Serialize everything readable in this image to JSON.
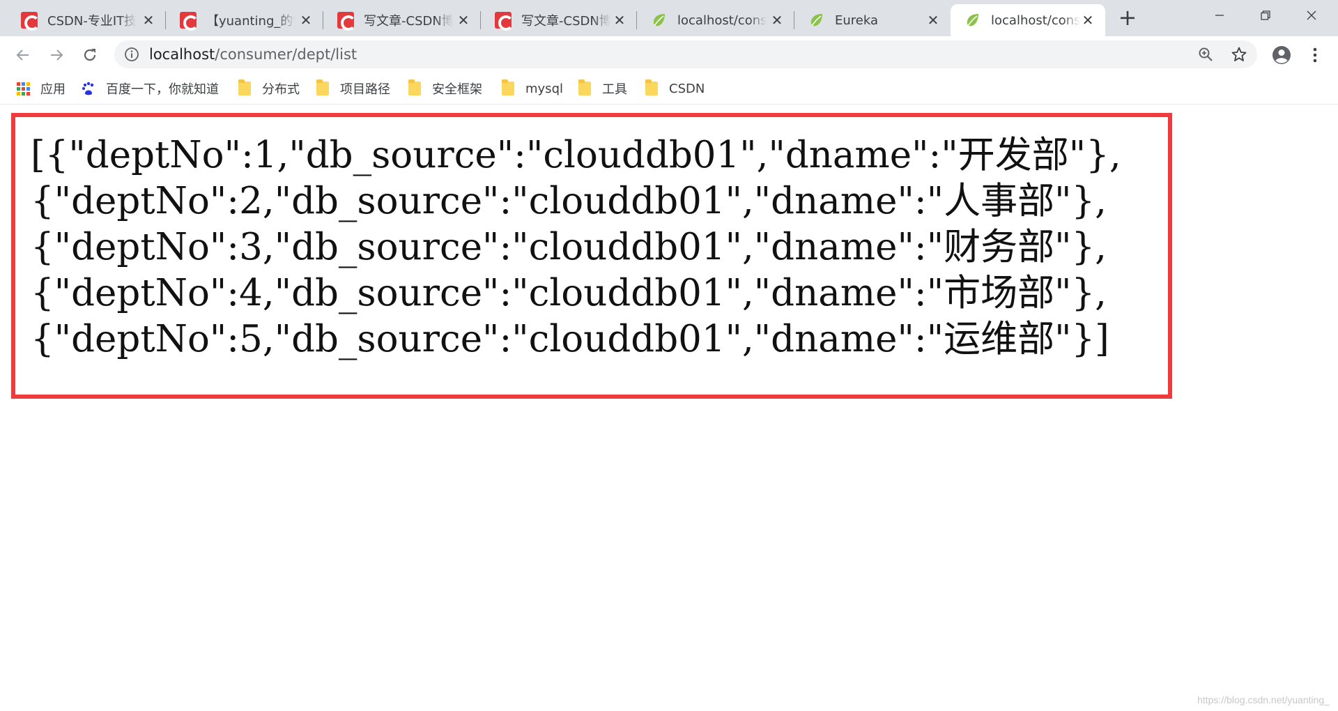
{
  "tabs": [
    {
      "title": "CSDN-专业IT技",
      "favicon": "csdn-icon",
      "active": false
    },
    {
      "title": "【yuanting_的博",
      "favicon": "csdn-icon",
      "active": false
    },
    {
      "title": "写文章-CSDN博",
      "favicon": "csdn-icon",
      "active": false
    },
    {
      "title": "写文章-CSDN博",
      "favicon": "csdn-icon",
      "active": false
    },
    {
      "title": "localhost/cons",
      "favicon": "spring-leaf-icon",
      "active": false
    },
    {
      "title": "Eureka",
      "favicon": "spring-leaf-icon",
      "active": false
    },
    {
      "title": "localhost/cons",
      "favicon": "spring-leaf-icon",
      "active": true
    }
  ],
  "close_glyph": "✕",
  "new_tab_glyph": "+",
  "address_bar": {
    "host": "localhost",
    "path": "/consumer/dept/list"
  },
  "bookmarks": [
    {
      "label": "应用",
      "icon": "apps-grid-icon"
    },
    {
      "label": "百度一下，你就知道",
      "icon": "baidu-paw-icon"
    },
    {
      "label": "分布式",
      "icon": "folder-icon"
    },
    {
      "label": "项目路径",
      "icon": "folder-icon"
    },
    {
      "label": "安全框架",
      "icon": "folder-icon"
    },
    {
      "label": "mysql",
      "icon": "folder-icon"
    },
    {
      "label": "工具",
      "icon": "folder-icon"
    },
    {
      "label": "CSDN",
      "icon": "folder-icon"
    }
  ],
  "page": {
    "json_lines": [
      "[{\"deptNo\":1,\"db_source\":\"clouddb01\",\"dname\":\"开发部\"},",
      "{\"deptNo\":2,\"db_source\":\"clouddb01\",\"dname\":\"人事部\"},",
      "{\"deptNo\":3,\"db_source\":\"clouddb01\",\"dname\":\"财务部\"},",
      "{\"deptNo\":4,\"db_source\":\"clouddb01\",\"dname\":\"市场部\"},",
      "{\"deptNo\":5,\"db_source\":\"clouddb01\",\"dname\":\"运维部\"}]"
    ],
    "highlight_color": "#ef3b3b"
  },
  "watermark": "https://blog.csdn.net/yuanting_",
  "colors": {
    "tabstrip": "#dee1e6",
    "csdn_red": "#e4393c",
    "spring_green": "#6db33f",
    "folder": "#fbd85d"
  }
}
